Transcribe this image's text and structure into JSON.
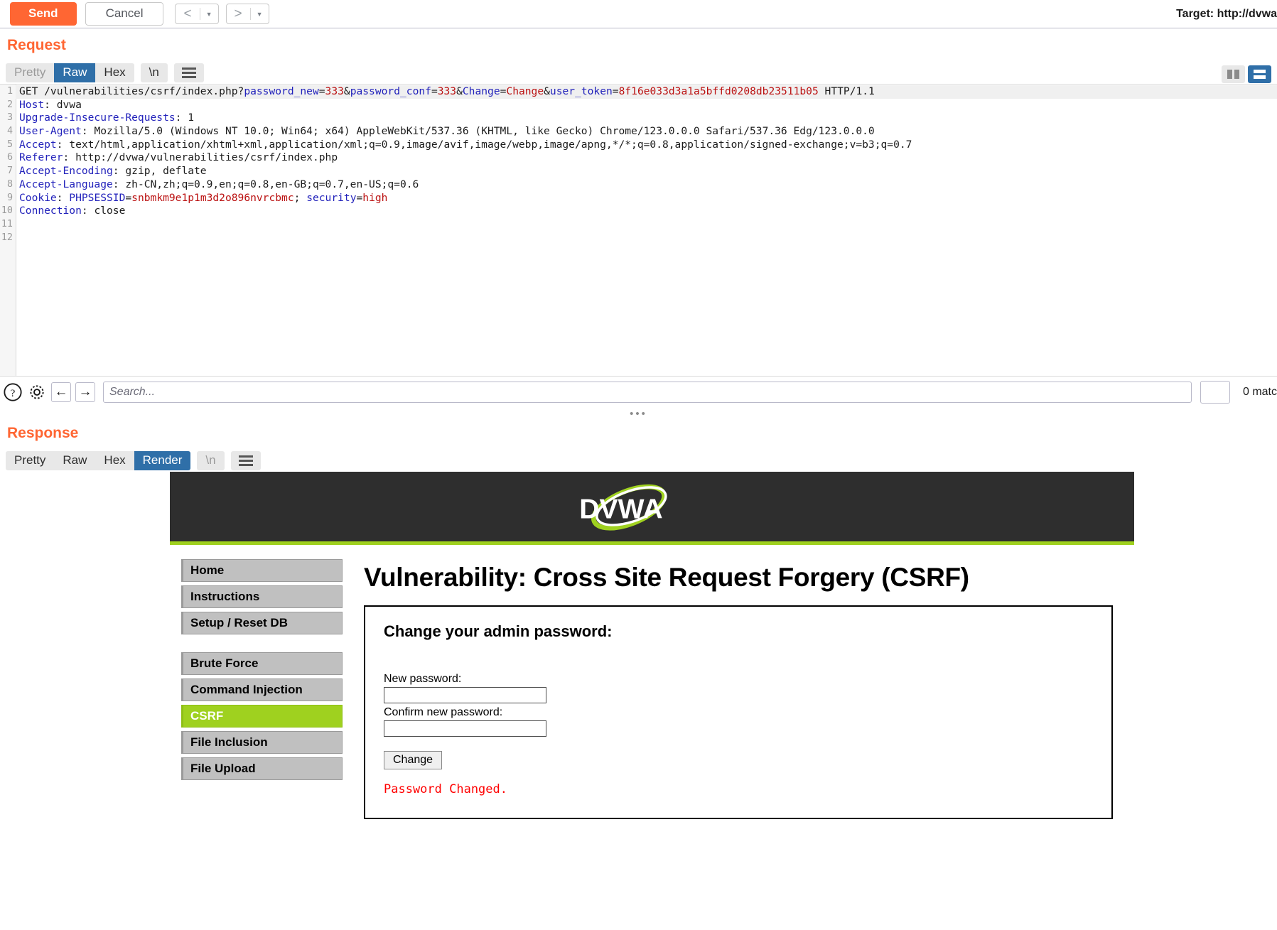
{
  "toolbar": {
    "send_label": "Send",
    "cancel_label": "Cancel",
    "prev_arrow": "<",
    "next_arrow": ">",
    "caret": "▼",
    "target_label": "Target: http://dvwa"
  },
  "request": {
    "section_title": "Request",
    "tabs": [
      {
        "label": "Pretty",
        "active": false,
        "muted": true
      },
      {
        "label": "Raw",
        "active": true,
        "muted": false
      },
      {
        "label": "Hex",
        "active": false,
        "muted": false
      }
    ],
    "newline_tab": "\\n",
    "menu_icon": "hamburger-icon",
    "lines": [
      {
        "n": "1",
        "segments": [
          {
            "t": "GET /vulnerabilities/csrf/index.php?",
            "c": "v"
          },
          {
            "t": "password_new",
            "c": "k"
          },
          {
            "t": "=",
            "c": "v"
          },
          {
            "t": "333",
            "c": "r"
          },
          {
            "t": "&",
            "c": "v"
          },
          {
            "t": "password_conf",
            "c": "k"
          },
          {
            "t": "=",
            "c": "v"
          },
          {
            "t": "333",
            "c": "r"
          },
          {
            "t": "&",
            "c": "v"
          },
          {
            "t": "Change",
            "c": "k"
          },
          {
            "t": "=",
            "c": "v"
          },
          {
            "t": "Change",
            "c": "r"
          },
          {
            "t": "&",
            "c": "v"
          },
          {
            "t": "user_token",
            "c": "k"
          },
          {
            "t": "=",
            "c": "v"
          },
          {
            "t": "8f16e033d3a1a5bffd0208db23511b05",
            "c": "r"
          },
          {
            "t": " HTTP/1.1",
            "c": "v"
          }
        ]
      },
      {
        "n": "2",
        "segments": [
          {
            "t": "Host",
            "c": "k"
          },
          {
            "t": ": dvwa",
            "c": "v"
          }
        ]
      },
      {
        "n": "3",
        "segments": [
          {
            "t": "Upgrade-Insecure-Requests",
            "c": "k"
          },
          {
            "t": ": 1",
            "c": "v"
          }
        ]
      },
      {
        "n": "4",
        "segments": [
          {
            "t": "User-Agent",
            "c": "k"
          },
          {
            "t": ": Mozilla/5.0 (Windows NT 10.0; Win64; x64) AppleWebKit/537.36 (KHTML, like Gecko) Chrome/123.0.0.0 Safari/537.36 Edg/123.0.0.0",
            "c": "v"
          }
        ]
      },
      {
        "n": "5",
        "segments": [
          {
            "t": "Accept",
            "c": "k"
          },
          {
            "t": ": text/html,application/xhtml+xml,application/xml;q=0.9,image/avif,image/webp,image/apng,*/*;q=0.8,application/signed-exchange;v=b3;q=0.7",
            "c": "v"
          }
        ]
      },
      {
        "n": "6",
        "segments": [
          {
            "t": "Referer",
            "c": "k"
          },
          {
            "t": ": http://dvwa/vulnerabilities/csrf/index.php",
            "c": "v"
          }
        ]
      },
      {
        "n": "7",
        "segments": [
          {
            "t": "Accept-Encoding",
            "c": "k"
          },
          {
            "t": ": gzip, deflate",
            "c": "v"
          }
        ]
      },
      {
        "n": "8",
        "segments": [
          {
            "t": "Accept-Language",
            "c": "k"
          },
          {
            "t": ": zh-CN,zh;q=0.9,en;q=0.8,en-GB;q=0.7,en-US;q=0.6",
            "c": "v"
          }
        ]
      },
      {
        "n": "9",
        "segments": [
          {
            "t": "Cookie",
            "c": "k"
          },
          {
            "t": ": ",
            "c": "v"
          },
          {
            "t": "PHPSESSID",
            "c": "k"
          },
          {
            "t": "=",
            "c": "v"
          },
          {
            "t": "snbmkm9e1p1m3d2o896nvrcbmc",
            "c": "r"
          },
          {
            "t": "; ",
            "c": "v"
          },
          {
            "t": "security",
            "c": "k"
          },
          {
            "t": "=",
            "c": "v"
          },
          {
            "t": "high",
            "c": "r"
          }
        ]
      },
      {
        "n": "10",
        "segments": [
          {
            "t": "Connection",
            "c": "k"
          },
          {
            "t": ": close",
            "c": "v"
          }
        ]
      },
      {
        "n": "11",
        "segments": []
      },
      {
        "n": "12",
        "segments": []
      }
    ]
  },
  "search": {
    "help_icon": "question-mark-icon",
    "settings_icon": "gear-icon",
    "prev_icon": "←",
    "next_icon": "→",
    "placeholder": "Search...",
    "value": "",
    "match_count_label": "0 matc"
  },
  "response": {
    "section_title": "Response",
    "tabs": [
      {
        "label": "Pretty",
        "active": false,
        "muted": false
      },
      {
        "label": "Raw",
        "active": false,
        "muted": false
      },
      {
        "label": "Hex",
        "active": false,
        "muted": false
      },
      {
        "label": "Render",
        "active": true,
        "muted": false
      }
    ],
    "newline_tab": "\\n",
    "menu_icon": "hamburger-icon"
  },
  "dvwa": {
    "logo_text": "DVWA",
    "sidebar": [
      {
        "label": "Home",
        "active": false
      },
      {
        "label": "Instructions",
        "active": false
      },
      {
        "label": "Setup / Reset DB",
        "active": false
      },
      {
        "label": "__GAP__",
        "active": false
      },
      {
        "label": "Brute Force",
        "active": false
      },
      {
        "label": "Command Injection",
        "active": false
      },
      {
        "label": "CSRF",
        "active": true
      },
      {
        "label": "File Inclusion",
        "active": false
      },
      {
        "label": "File Upload",
        "active": false
      }
    ],
    "page_title": "Vulnerability: Cross Site Request Forgery (CSRF)",
    "form": {
      "heading": "Change your admin password:",
      "new_password_label": "New password:",
      "new_password_value": "",
      "confirm_password_label": "Confirm new password:",
      "confirm_password_value": "",
      "submit_label": "Change",
      "status_message": "Password Changed."
    }
  },
  "colors": {
    "accent_orange": "#ff6633",
    "tab_active_blue": "#2f6fa8",
    "dvwa_green": "#9fd11f",
    "error_red": "#ff0000"
  }
}
